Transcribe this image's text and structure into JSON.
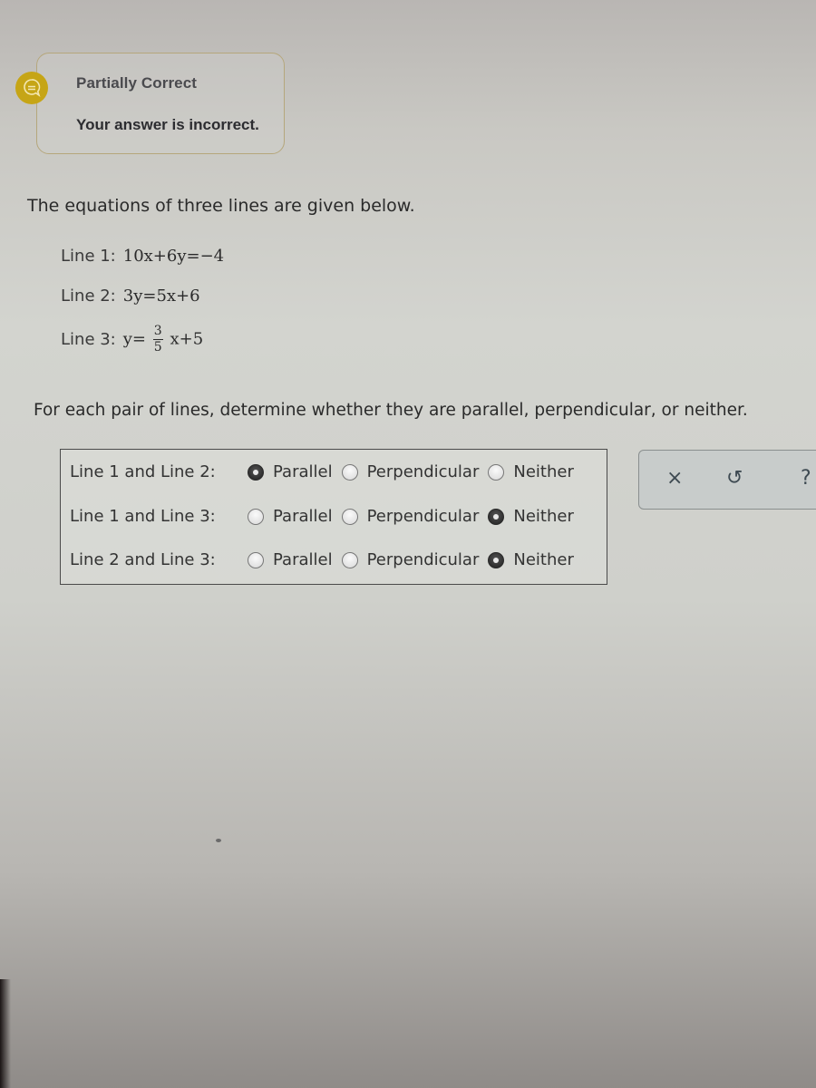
{
  "feedback": {
    "icon": "speech-bubble-icon",
    "status": "Partially Correct",
    "message": "Your answer is incorrect.",
    "color": "#c6a516"
  },
  "problem": {
    "intro": "The equations of three lines are given below.",
    "lines": [
      {
        "label": "Line 1:",
        "equation": "10x+6y=−4"
      },
      {
        "label": "Line 2:",
        "equation": "3y=5x+6"
      },
      {
        "label": "Line 3:",
        "equation_lhs": "y=",
        "frac_num": "3",
        "frac_den": "5",
        "equation_rhs": "x+5"
      }
    ],
    "instruction": "For each pair of lines, determine whether they are parallel, perpendicular, or neither."
  },
  "answers": {
    "options": [
      "Parallel",
      "Perpendicular",
      "Neither"
    ],
    "pairs": [
      {
        "label": "Line 1 and Line 2:",
        "selected": "Parallel"
      },
      {
        "label": "Line 1 and Line 3:",
        "selected": "Neither"
      },
      {
        "label": "Line 2 and Line 3:",
        "selected": "Neither"
      }
    ]
  },
  "tools": {
    "clear": "×",
    "undo": "↺",
    "help": "?"
  }
}
